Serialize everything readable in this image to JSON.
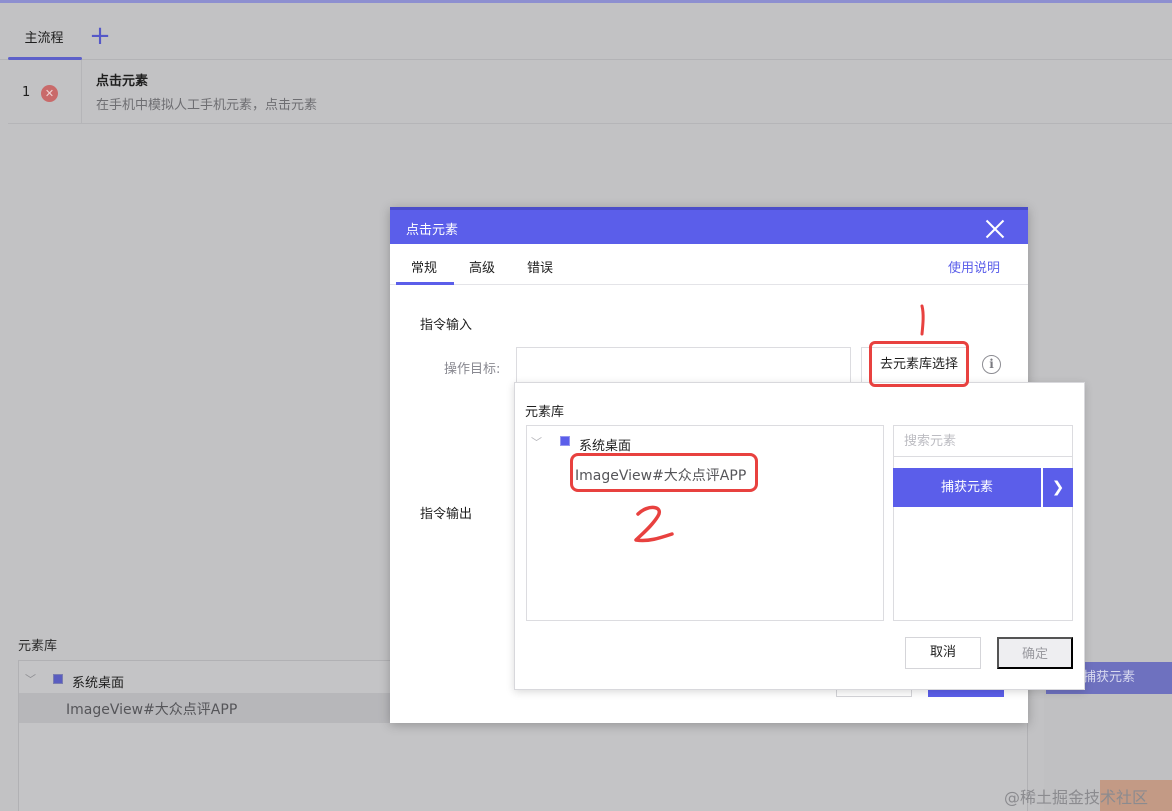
{
  "main_tabs": {
    "active_label": "主流程",
    "add_icon": "plus-icon"
  },
  "steps": [
    {
      "number": "1",
      "title": "点击元素",
      "description": "在手机中模拟人工手机元素，点击元素"
    }
  ],
  "bg_library": {
    "label": "元素库",
    "root_node": "系统桌面",
    "child_node": "ImageView#大众点评APP",
    "capture_label": "捕获元素"
  },
  "dialog": {
    "title": "点击元素",
    "tabs": [
      "常规",
      "高级",
      "错误"
    ],
    "help_link": "使用说明",
    "section_input": "指令输入",
    "target_label": "操作目标:",
    "target_value": "",
    "goto_library_label": "去元素库选择",
    "section_output": "指令输出"
  },
  "popover": {
    "title": "元素库",
    "root_node": "系统桌面",
    "child_node": "ImageView#大众点评APP",
    "search_placeholder": "搜索元素",
    "capture_label": "捕获元素",
    "cancel_label": "取消",
    "ok_label": "确定"
  },
  "watermark": "@稀土掘金技术社区",
  "colors": {
    "accent": "#5b5eea",
    "annotation": "#e8413f",
    "overlay": "#c2c2c4"
  }
}
